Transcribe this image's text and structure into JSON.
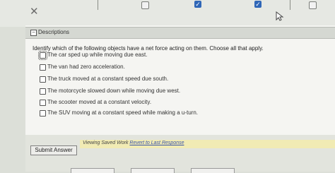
{
  "toolbar": {
    "close_glyph": "✕"
  },
  "descriptions": {
    "label": "Descriptions",
    "toggle_glyph": "−"
  },
  "question": {
    "prompt": "Identify which of the following objects have a net force acting on them. Choose all that apply.",
    "options": [
      {
        "label": "The car sped up while moving due east.",
        "checked": false
      },
      {
        "label": "The van had zero acceleration.",
        "checked": false
      },
      {
        "label": "The truck moved at a constant speed due south.",
        "checked": false
      },
      {
        "label": "The motorcycle slowed down while moving due west.",
        "checked": false
      },
      {
        "label": "The scooter moved at a constant velocity.",
        "checked": false
      },
      {
        "label": "The SUV moving at a constant speed while making a u-turn.",
        "checked": false
      }
    ]
  },
  "footer": {
    "submit_label": "Submit Answer",
    "saved_text": "Viewing Saved Work",
    "revert_link": "Revert to Last Response"
  },
  "colors": {
    "checkbox_accent": "#2f66b7",
    "saved_banner": "#f1ebb4",
    "link": "#3a54a8"
  }
}
